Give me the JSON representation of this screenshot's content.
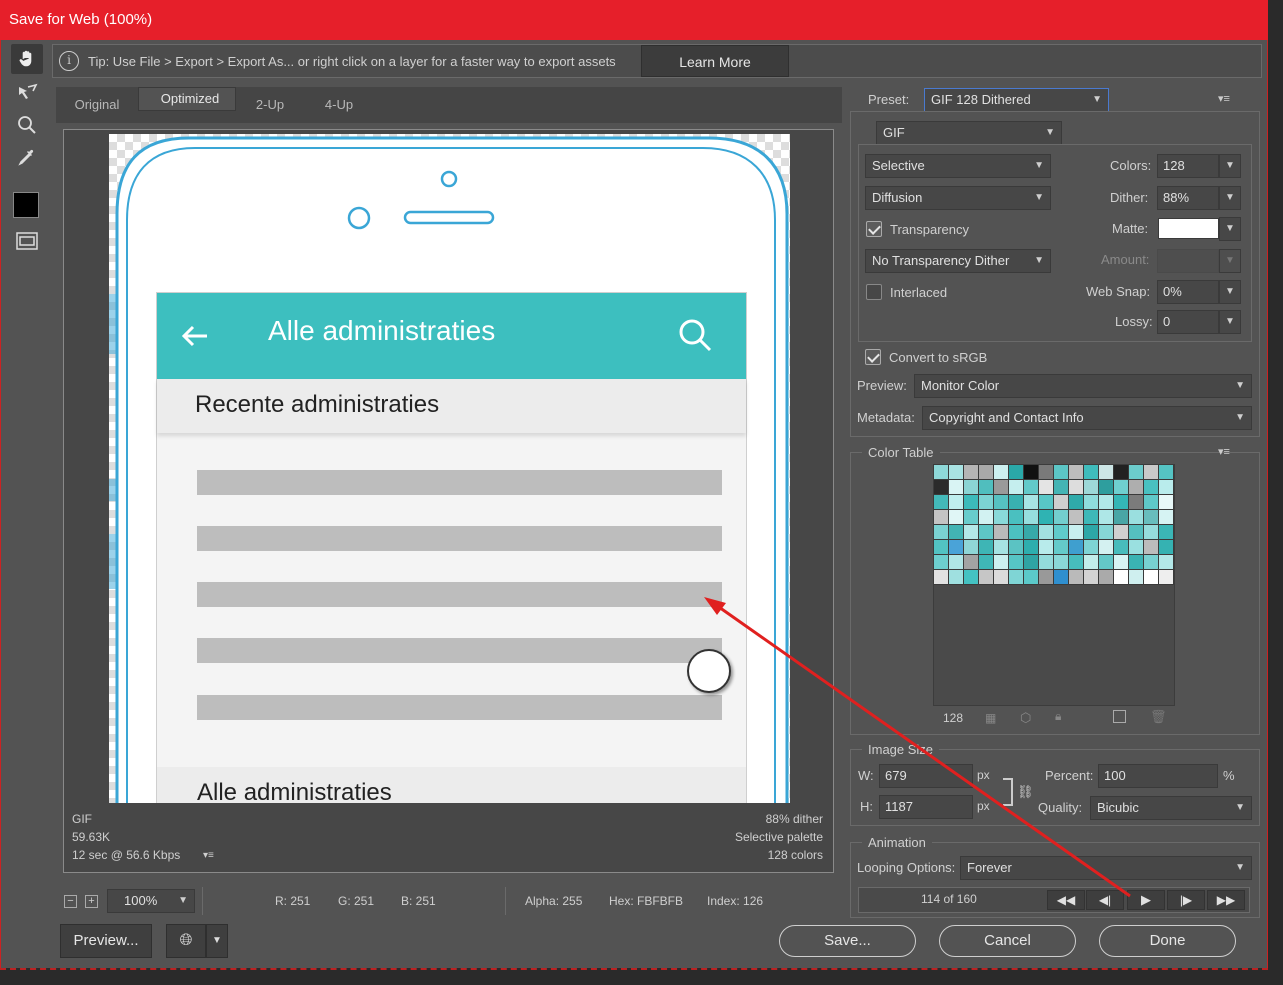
{
  "window": {
    "title": "Save for Web (100%)"
  },
  "tip": {
    "text": "Tip: Use File > Export > Export As...  or right click on a layer for a faster way to export assets",
    "learn_more": "Learn More"
  },
  "tabs": [
    {
      "label": "Original"
    },
    {
      "label": "Optimized"
    },
    {
      "label": "2-Up"
    },
    {
      "label": "4-Up"
    }
  ],
  "canvas": {
    "appbar_title": "Alle administraties",
    "section1": "Recente administraties",
    "section2": "Alle administraties",
    "accent": "#3dbfbf",
    "frame_color": "#3aa6d6"
  },
  "preview_info": {
    "format": "GIF",
    "size": "59.63K",
    "speed": "12 sec @ 56.6 Kbps",
    "dither": "88% dither",
    "palette": "Selective palette",
    "colors": "128 colors"
  },
  "settings": {
    "preset_label": "Preset:",
    "preset": "GIF 128 Dithered",
    "format": "GIF",
    "reduction": "Selective",
    "colors_label": "Colors:",
    "colors": "128",
    "dither_algo": "Diffusion",
    "dither_label": "Dither:",
    "dither": "88%",
    "transparency_label": "Transparency",
    "matte_label": "Matte:",
    "trans_dither": "No Transparency Dither",
    "amount_label": "Amount:",
    "interlaced_label": "Interlaced",
    "websnap_label": "Web Snap:",
    "websnap": "0%",
    "lossy_label": "Lossy:",
    "lossy": "0",
    "srgb_label": "Convert to sRGB",
    "preview_label": "Preview:",
    "preview_val": "Monitor Color",
    "metadata_label": "Metadata:",
    "metadata_val": "Copyright and Contact Info"
  },
  "color_table": {
    "title": "Color Table",
    "count": "128",
    "colors": [
      "#8ed8d8",
      "#a9e3e3",
      "#b5b5b5",
      "#a9a9a9",
      "#ccf0f0",
      "#2aa8a8",
      "#111111",
      "#7a7a7a",
      "#5cc6c6",
      "#bdbdbd",
      "#3fbcbc",
      "#cde6e6",
      "#222222",
      "#6ccccc",
      "#c9c9c9",
      "#55c4c4",
      "#2b2b2b",
      "#d9f4f4",
      "#8bd4d4",
      "#50bebe",
      "#9a9a9a",
      "#c5eeee",
      "#62c9c9",
      "#e4e4e4",
      "#44b4b4",
      "#dddddd",
      "#9dd8d8",
      "#2e9e9e",
      "#6fd0d0",
      "#aeaeae",
      "#49c1c1",
      "#b9ecec",
      "#43b9b9",
      "#bfeeee",
      "#3cbaba",
      "#7cd3d3",
      "#56c1c1",
      "#39b1b1",
      "#a7e5e5",
      "#58c7c7",
      "#cfcfcf",
      "#2faaaa",
      "#8fdcdc",
      "#b1e9e9",
      "#34b6b6",
      "#7b7b7b",
      "#5fc8c8",
      "#e8f8f8",
      "#c4c4c4",
      "#e0f6f6",
      "#68cccc",
      "#d2f2f2",
      "#89d9d9",
      "#4ac0c0",
      "#97dede",
      "#2fb3b3",
      "#73cece",
      "#c0c0c0",
      "#3eb8b8",
      "#aee7e7",
      "#49a6a6",
      "#9adfdf",
      "#68bdbd",
      "#d6f3f3",
      "#7ad2d2",
      "#42b4b4",
      "#b4e8e8",
      "#5ec6c6",
      "#bababa",
      "#4cc1c1",
      "#37a9a9",
      "#a2e1e1",
      "#60cbcb",
      "#c8efef",
      "#2da7a7",
      "#86d7d7",
      "#d0d0d0",
      "#55bfbf",
      "#96dcdc",
      "#3bb6b6",
      "#52c3c3",
      "#4aa3d8",
      "#8fd6d6",
      "#3eb5b5",
      "#a6e3e3",
      "#5bc3c3",
      "#2eaeae",
      "#b8ebeb",
      "#64caca",
      "#3f9fcf",
      "#7ed4d4",
      "#d4f1f1",
      "#48bcbc",
      "#9ae0e0",
      "#bcbcbc",
      "#35b2b2",
      "#6dcfcf",
      "#b0e6e6",
      "#a3a3a3",
      "#3fb7b7",
      "#cbf0f0",
      "#56c5c5",
      "#2fa4a4",
      "#93dbdb",
      "#8ad8d8",
      "#47bdbd",
      "#c2edea",
      "#64c8c8",
      "#d8f5f5",
      "#3ab3b3",
      "#78d1d1",
      "#b3e8e8",
      "#e2e2e2",
      "#9fe0e0",
      "#44c2c2",
      "#c6c6c6",
      "#dbdbdb",
      "#7fd5d5",
      "#5bc9c9",
      "#999999",
      "#2f8fcf",
      "#bababa",
      "#d3d3d3",
      "#aaaaaa",
      "#ffffff",
      "#cfefef",
      "#ffffff",
      "#eeeeee"
    ]
  },
  "image_size": {
    "title": "Image Size",
    "w_label": "W:",
    "w": "679",
    "h_label": "H:",
    "h": "1187",
    "unit": "px",
    "percent_label": "Percent:",
    "percent": "100",
    "percent_unit": "%",
    "quality_label": "Quality:",
    "quality": "Bicubic"
  },
  "animation": {
    "title": "Animation",
    "looping_label": "Looping Options:",
    "looping": "Forever",
    "frame": "114 of 160"
  },
  "status": {
    "zoom": "100%",
    "r": "R: 251",
    "g": "G: 251",
    "b": "B: 251",
    "alpha": "Alpha: 255",
    "hex": "Hex: FBFBFB",
    "index": "Index: 126"
  },
  "buttons": {
    "preview": "Preview...",
    "save": "Save...",
    "cancel": "Cancel",
    "done": "Done"
  }
}
